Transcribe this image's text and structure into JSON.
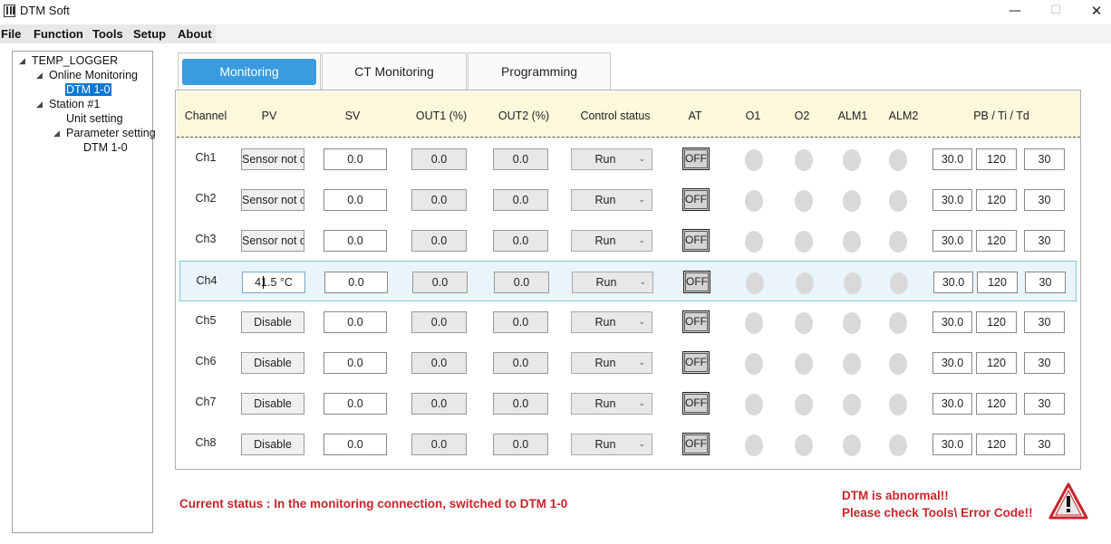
{
  "window": {
    "title": "DTM Soft",
    "minimize": "—",
    "maximize": "☐",
    "close": "✕"
  },
  "menu": [
    "File",
    "Function",
    "Tools",
    "Setup",
    "About"
  ],
  "tree": {
    "root": "TEMP_LOGGER",
    "online_monitoring": "Online Monitoring",
    "online_device": "DTM 1-0",
    "station": "Station #1",
    "unit_setting": "Unit setting",
    "parameter_setting": "Parameter setting",
    "param_device": "DTM 1-0"
  },
  "tabs": [
    "Monitoring",
    "CT Monitoring",
    "Programming"
  ],
  "active_tab": "Monitoring",
  "columns": [
    "Channel",
    "PV",
    "SV",
    "OUT1 (%)",
    "OUT2 (%)",
    "Control status",
    "AT",
    "O1",
    "O2",
    "ALM1",
    "ALM2",
    "PB / Ti / Td"
  ],
  "channels": [
    {
      "ch": "Ch1",
      "pv": "Sensor not c",
      "sv": "0.0",
      "out1": "0.0",
      "out2": "0.0",
      "control": "Run",
      "at": "OFF",
      "pb": "30.0",
      "ti": "120",
      "td": "30"
    },
    {
      "ch": "Ch2",
      "pv": "Sensor not c",
      "sv": "0.0",
      "out1": "0.0",
      "out2": "0.0",
      "control": "Run",
      "at": "OFF",
      "pb": "30.0",
      "ti": "120",
      "td": "30"
    },
    {
      "ch": "Ch3",
      "pv": "Sensor not c",
      "sv": "0.0",
      "out1": "0.0",
      "out2": "0.0",
      "control": "Run",
      "at": "OFF",
      "pb": "30.0",
      "ti": "120",
      "td": "30"
    },
    {
      "ch": "Ch4",
      "pv": "41.5 °C",
      "sv": "0.0",
      "out1": "0.0",
      "out2": "0.0",
      "control": "Run",
      "at": "OFF",
      "pb": "30.0",
      "ti": "120",
      "td": "30"
    },
    {
      "ch": "Ch5",
      "pv": "Disable",
      "sv": "0.0",
      "out1": "0.0",
      "out2": "0.0",
      "control": "Run",
      "at": "OFF",
      "pb": "30.0",
      "ti": "120",
      "td": "30"
    },
    {
      "ch": "Ch6",
      "pv": "Disable",
      "sv": "0.0",
      "out1": "0.0",
      "out2": "0.0",
      "control": "Run",
      "at": "OFF",
      "pb": "30.0",
      "ti": "120",
      "td": "30"
    },
    {
      "ch": "Ch7",
      "pv": "Disable",
      "sv": "0.0",
      "out1": "0.0",
      "out2": "0.0",
      "control": "Run",
      "at": "OFF",
      "pb": "30.0",
      "ti": "120",
      "td": "30"
    },
    {
      "ch": "Ch8",
      "pv": "Disable",
      "sv": "0.0",
      "out1": "0.0",
      "out2": "0.0",
      "control": "Run",
      "at": "OFF",
      "pb": "30.0",
      "ti": "120",
      "td": "30"
    }
  ],
  "selected_channel": "Ch4",
  "status": {
    "message": "Current status : In the monitoring connection, switched to DTM 1-0",
    "alarm_line1": "DTM is abnormal!!",
    "alarm_line2": "Please check Tools\\ Error Code!!",
    "alarm_color": "#c8252b"
  },
  "colors": {
    "accent": "#3a9be0",
    "header_bg": "#fcf8dc",
    "selected_row": "#eaf4fb",
    "led_off": "#d9d9d9"
  },
  "icons": {
    "dropdown": "chevron-down-icon",
    "warning": "warning-triangle-icon",
    "tree_expand": "tree-expand-icon"
  }
}
